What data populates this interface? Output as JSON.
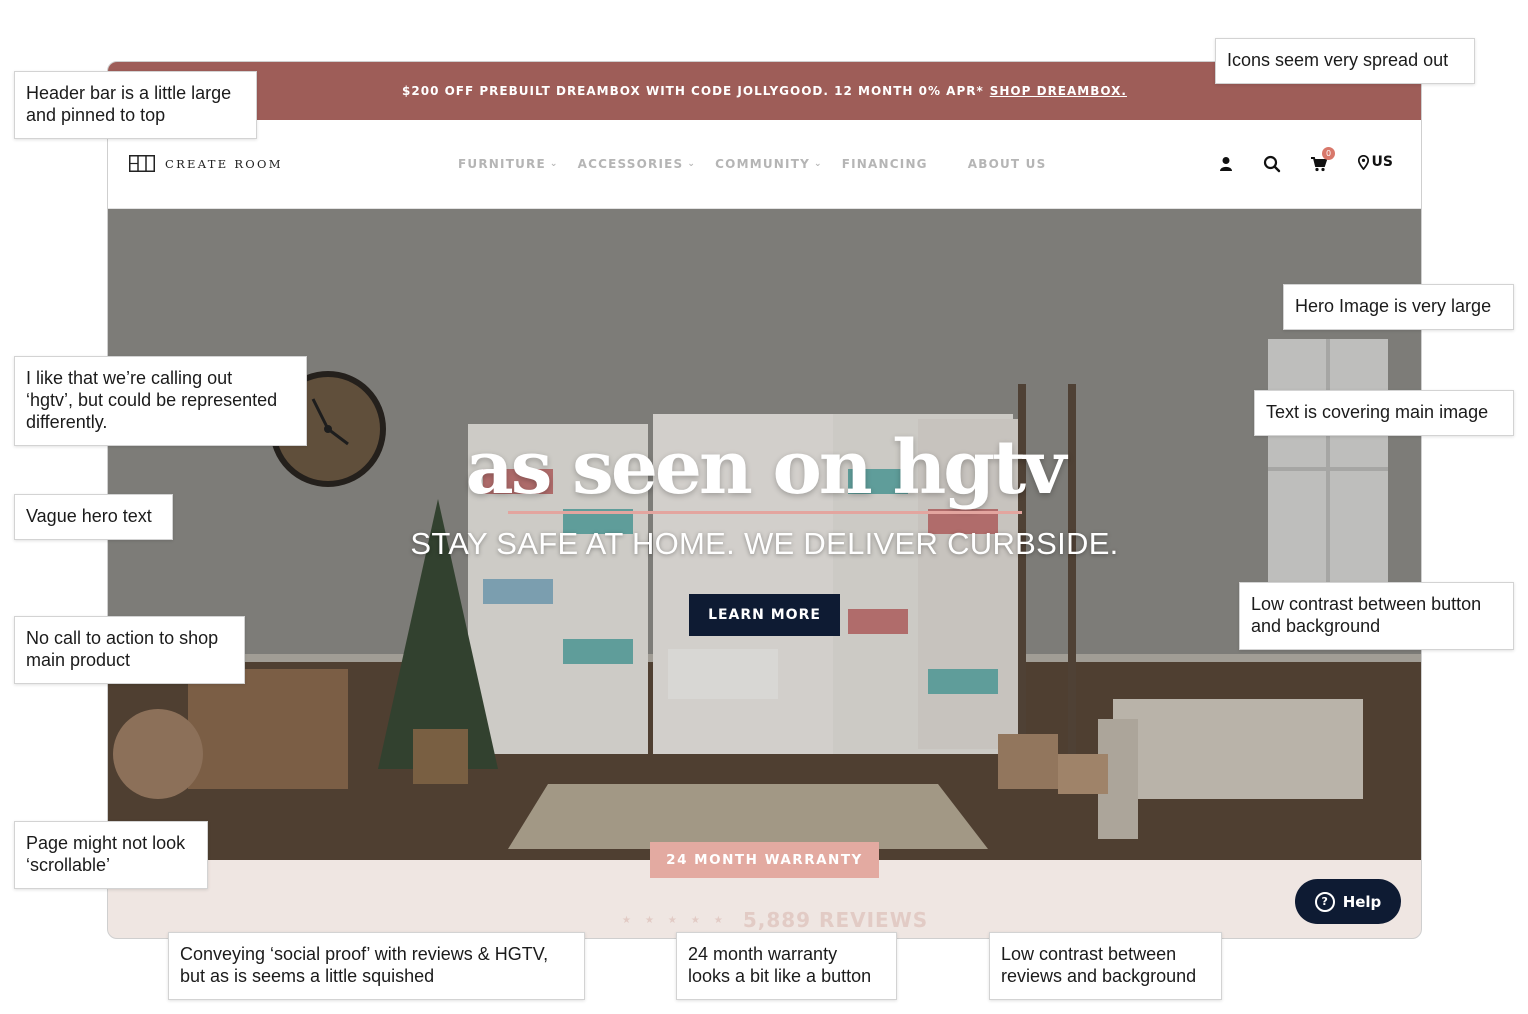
{
  "promo_bar": {
    "text": "$200 OFF PREBUILT DREAMBOX WITH CODE JOLLYGOOD. 12 MONTH 0% APR*",
    "link": "SHOP DREAMBOX.",
    "bg_color": "#9e5d58"
  },
  "brand": {
    "name": "CREATE ROOM"
  },
  "nav": {
    "items": [
      {
        "label": "FURNITURE",
        "has_dropdown": true
      },
      {
        "label": "ACCESSORIES",
        "has_dropdown": true
      },
      {
        "label": "COMMUNITY",
        "has_dropdown": true
      },
      {
        "label": "FINANCING",
        "has_dropdown": false
      },
      {
        "label": "ABOUT US",
        "has_dropdown": false
      }
    ],
    "icons": [
      "user-icon",
      "search-icon",
      "cart-icon",
      "location-pin-icon"
    ],
    "cart_count": "0",
    "region": "US"
  },
  "hero": {
    "headline": "as seen on hgtv",
    "subheadline": "STAY SAFE AT HOME. WE DELIVER CURBSIDE.",
    "cta": "LEARN MORE",
    "cta_color": "#0e1b33"
  },
  "warranty": {
    "label": "24 MONTH WARRANTY",
    "color": "#e3aaa1"
  },
  "reviews": {
    "stars": "★★★★★",
    "text": "5,889 REVIEWS"
  },
  "help": {
    "label": "Help"
  },
  "annotations": [
    {
      "text": "Header bar is a little large\nand pinned to top"
    },
    {
      "text": "Icons seem very spread out"
    },
    {
      "text": "Hero Image is very large"
    },
    {
      "text": "I like that we’re calling out\n‘hgtv’, but could be represented\ndifferently."
    },
    {
      "text": "Text is covering main image"
    },
    {
      "text": "Vague hero text"
    },
    {
      "text": "Low contrast between button\nand background"
    },
    {
      "text": "No call to action to shop\nmain product"
    },
    {
      "text": "Page might not look\n‘scrollable’"
    },
    {
      "text": "Conveying ‘social proof’ with reviews & HGTV,\nbut as is seems a little squished"
    },
    {
      "text": "24 month warranty\nlooks a bit like a button"
    },
    {
      "text": "Low contrast between\nreviews and background"
    }
  ]
}
